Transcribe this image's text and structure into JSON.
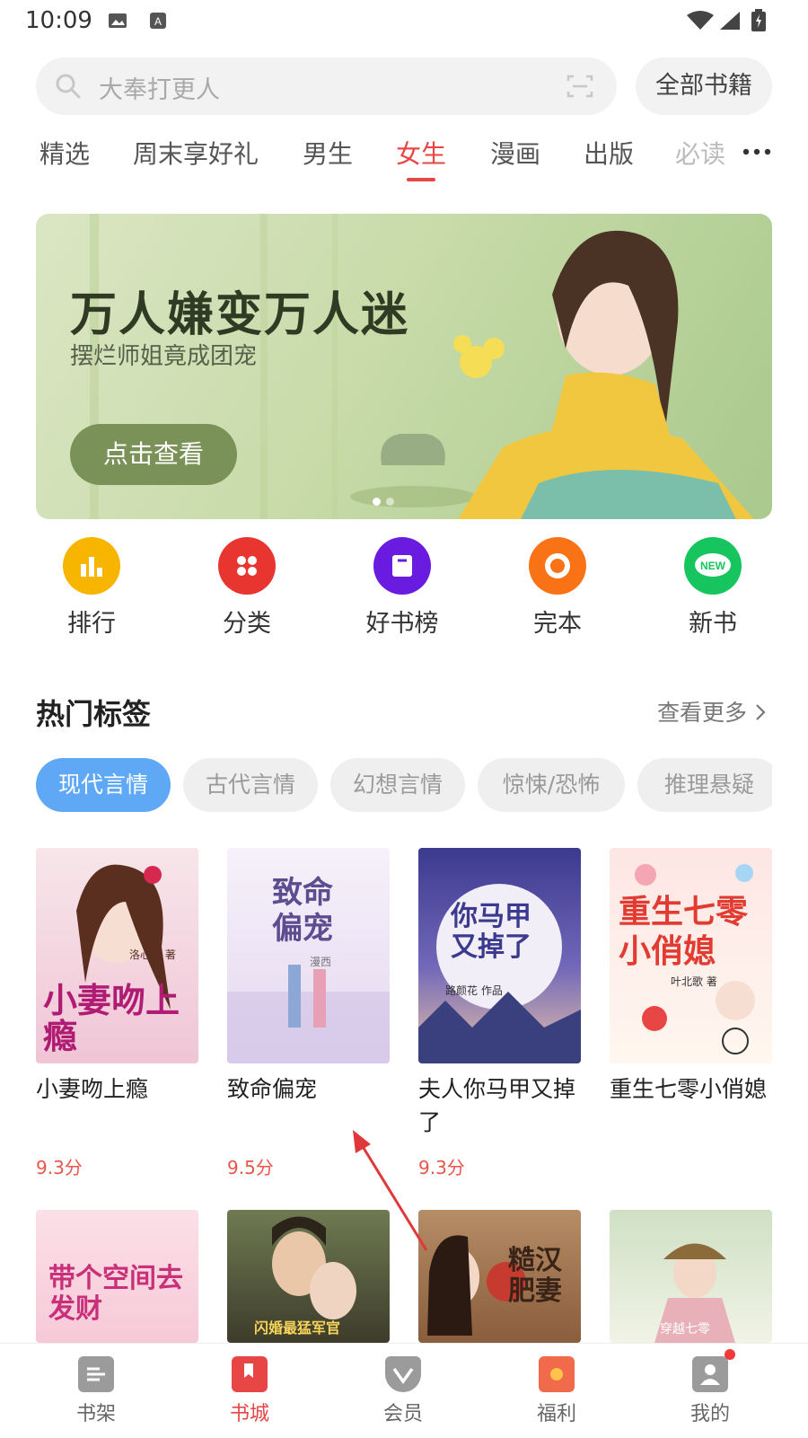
{
  "status_bar": {
    "time": "10:09"
  },
  "search": {
    "placeholder": "大奉打更人",
    "all_books": "全部书籍"
  },
  "tabs": [
    {
      "label": "精选"
    },
    {
      "label": "周末享好礼"
    },
    {
      "label": "男生"
    },
    {
      "label": "女生",
      "active": true
    },
    {
      "label": "漫画"
    },
    {
      "label": "出版"
    },
    {
      "label": "必读"
    }
  ],
  "banner": {
    "title": "万人嫌变万人迷",
    "subtitle": "摆烂师姐竟成团宠",
    "cta": "点击查看"
  },
  "shortcuts": [
    {
      "label": "排行",
      "icon": "chart-icon",
      "color": "#f7b500"
    },
    {
      "label": "分类",
      "icon": "category-icon",
      "color": "#e8352f"
    },
    {
      "label": "好书榜",
      "icon": "bookmark-box-icon",
      "color": "#6a1be0"
    },
    {
      "label": "完本",
      "icon": "ring-icon",
      "color": "#f97316"
    },
    {
      "label": "新书",
      "icon": "new-badge-icon",
      "color": "#16c55e",
      "badge_text": "NEW"
    }
  ],
  "hot_tags": {
    "title": "热门标签",
    "see_more": "查看更多",
    "chips": [
      "现代言情",
      "古代言情",
      "幻想言情",
      "惊悚/恐怖",
      "推理悬疑"
    ]
  },
  "books": [
    {
      "title": "小妻吻上瘾",
      "score": "9.3分",
      "cover_text": "小妻吻上瘾",
      "cover_author": "洛心辰 著"
    },
    {
      "title": "致命偏宠",
      "score": "9.5分",
      "cover_text": "致命偏宠",
      "cover_author": "漫西"
    },
    {
      "title": "夫人你马甲又掉了",
      "score": "9.3分",
      "cover_text": "你马甲又掉了",
      "cover_author": "路颜花 作品"
    },
    {
      "title": "重生七零小俏媳",
      "score": "",
      "cover_text": "重生七零小俏媳",
      "cover_author": "叶北歌 著"
    }
  ],
  "books_row2": [
    {
      "cover_text": "带个空间去发财"
    },
    {
      "cover_text": "闪婚最猛军官"
    },
    {
      "cover_text": "糙汉肥妻"
    },
    {
      "cover_text": "穿越七零"
    }
  ],
  "bottom_nav": [
    {
      "label": "书架",
      "icon": "bookshelf-icon"
    },
    {
      "label": "书城",
      "icon": "bookstore-icon",
      "active": true
    },
    {
      "label": "会员",
      "icon": "vip-crown-icon"
    },
    {
      "label": "福利",
      "icon": "gift-icon"
    },
    {
      "label": "我的",
      "icon": "profile-icon",
      "has_dot": true
    }
  ],
  "colors": {
    "accent": "#e84545",
    "chip_active": "#5ea8f5",
    "score": "#e8564b"
  }
}
